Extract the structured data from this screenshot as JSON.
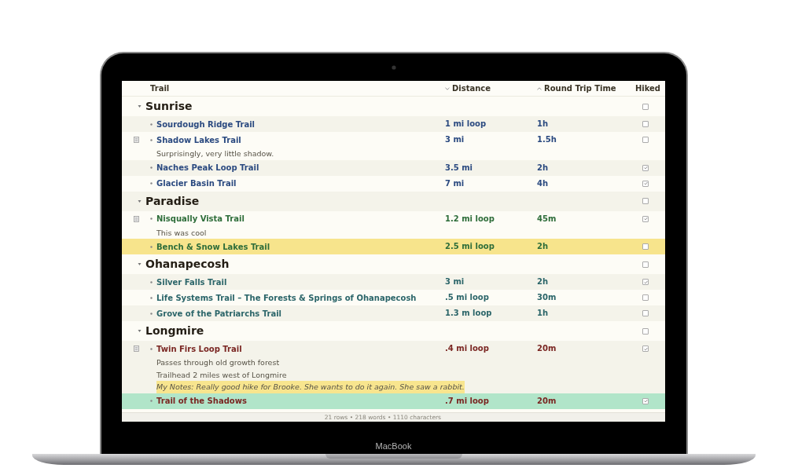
{
  "columns": [
    {
      "label": "Trail",
      "sorted": false
    },
    {
      "label": "Distance",
      "sorted": true,
      "ascending": false
    },
    {
      "label": "Round Trip Time",
      "sorted": true,
      "ascending": true
    },
    {
      "label": "Hiked",
      "sorted": false
    }
  ],
  "groups": [
    {
      "name": "Sunrise",
      "color": "#2b4a80",
      "expanded": true,
      "hiked": false,
      "trails": [
        {
          "name": "Sourdough Ridge Trail",
          "distance": "1 mi loop",
          "time": "1h",
          "hiked": false
        },
        {
          "name": "Shadow Lakes Trail",
          "distance": "3 mi",
          "time": "1.5h",
          "hiked": false,
          "notes": [
            {
              "kind": "plain",
              "text": "Surprisingly, very little shadow."
            }
          ]
        },
        {
          "name": "Naches Peak Loop Trail",
          "distance": "3.5 mi",
          "time": "2h",
          "hiked": true
        },
        {
          "name": "Glacier Basin Trail",
          "distance": "7 mi",
          "time": "4h",
          "hiked": true
        }
      ]
    },
    {
      "name": "Paradise",
      "color": "#2e6d3a",
      "expanded": true,
      "hiked": false,
      "trails": [
        {
          "name": "Nisqually Vista Trail",
          "distance": "1.2 mi loop",
          "time": "45m",
          "hiked": true,
          "notes": [
            {
              "kind": "plain",
              "text": "This was cool"
            }
          ]
        },
        {
          "name": "Bench & Snow Lakes Trail",
          "distance": "2.5 mi loop",
          "time": "2h",
          "hiked": false,
          "color": "#f7e48c"
        }
      ]
    },
    {
      "name": "Ohanapecosh",
      "color": "#2b6569",
      "expanded": true,
      "hiked": false,
      "trails": [
        {
          "name": "Silver Falls Trail",
          "distance": "3 mi",
          "time": "2h",
          "hiked": true
        },
        {
          "name": "Life Systems Trail – The Forests & Springs of Ohanapecosh",
          "distance": ".5 mi loop",
          "time": "30m",
          "hiked": false
        },
        {
          "name": "Grove of the Patriarchs Trail",
          "distance": "1.3 m loop",
          "time": "1h",
          "hiked": false
        }
      ]
    },
    {
      "name": "Longmire",
      "color": "#7a2622",
      "expanded": true,
      "hiked": false,
      "trails": [
        {
          "name": "Twin Firs Loop Trail",
          "distance": ".4 mi loop",
          "time": "20m",
          "hiked": true,
          "notes": [
            {
              "kind": "plain",
              "text": "Passes through old growth forest"
            },
            {
              "kind": "plain",
              "text": "Trailhead 2 miles west of Longmire"
            },
            {
              "kind": "mynote",
              "text": "My Notes: Really good hike for Brooke. She wants to do it again. She saw a rabbit."
            }
          ]
        },
        {
          "name": "Trail of the Shadows",
          "distance": ".7 mi loop",
          "time": "20m",
          "hiked": true,
          "color": "#b1e5c9"
        }
      ]
    }
  ],
  "status_bar": "21 rows • 218 words • 1110 characters",
  "device_label": "MacBook"
}
